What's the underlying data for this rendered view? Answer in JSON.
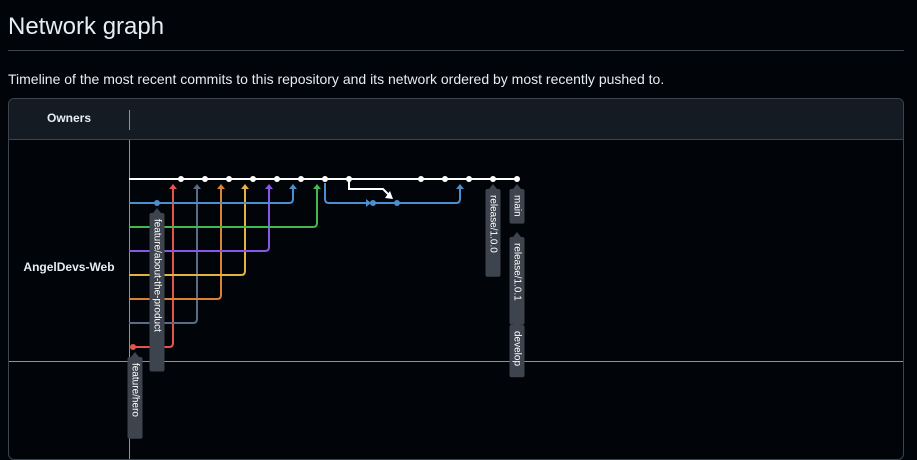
{
  "page": {
    "title": "Network graph",
    "description": "Timeline of the most recent commits to this repository and its network ordered by most recently pushed to."
  },
  "table": {
    "owners_header": "Owners",
    "owner": "AngelDevs-Web"
  },
  "graph": {
    "colors": {
      "main": "#ffffff",
      "blue": "#4d8ecf",
      "green": "#3fb950",
      "purple": "#8957e5",
      "yellow": "#e3b341",
      "orange": "#db8233",
      "slate": "#5a6d85",
      "red": "#e5534b",
      "label_bg": "#3d444d",
      "label_text": "#ffffff"
    },
    "branch_labels": [
      "feature/about-the-product",
      "release/1.0.0",
      "main",
      "release/1.0.1",
      "develop",
      "feature/hero"
    ]
  }
}
